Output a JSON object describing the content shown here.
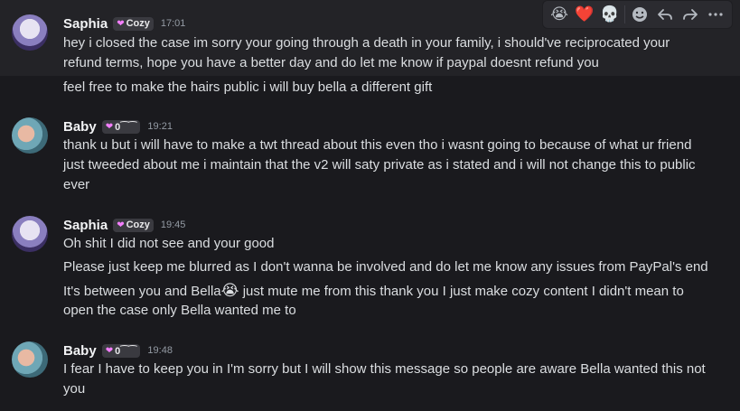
{
  "toolbar": {
    "reactions": [
      "😭",
      "❤️",
      "💀"
    ],
    "add_reaction_icon": "emoji-icon",
    "reply_icon": "reply-icon",
    "forward_icon": "forward-icon",
    "more_icon": "more-icon"
  },
  "messages": [
    {
      "author": "Saphia",
      "tag": "Cozy",
      "time": "17:01",
      "lines": [
        "hey i closed the case im sorry your going through a death in your family, i should've reciprocated your",
        "refund terms, hope you have a better day and do let me know if paypal doesnt refund you",
        "feel free to make the hairs public i will buy bella a different gift"
      ]
    },
    {
      "author": "Baby",
      "tag": "0⁀⁀",
      "time": "19:21",
      "lines": [
        "thank u but i will have to make a twt thread about this even tho i wasnt going to because of what ur friend",
        "just tweeded about me i maintain that the v2 will saty private as i stated and i will not change this to public",
        "ever"
      ]
    },
    {
      "author": "Saphia",
      "tag": "Cozy",
      "time": "19:45",
      "lines": [
        "Oh shit I did not see and your good",
        "Please just keep me blurred as I don't wanna be involved and do let me know any issues from PayPal's end",
        "It's between you and Bella",
        "😭",
        " just mute me from this thank you I just make cozy content I didn't mean to",
        "open the case only Bella wanted me to"
      ]
    },
    {
      "author": "Baby",
      "tag": "0⁀⁀",
      "time": "19:48",
      "lines": [
        "I fear I have to keep you in I'm sorry but I will show this message so people are aware Bella wanted this not",
        "you"
      ]
    }
  ],
  "colors": {
    "background": "#1a1a1e",
    "hover_background": "#232327",
    "text": "#dbdee1",
    "username": "#f2f3f5",
    "timestamp": "#949ba4",
    "tag_heart": "#f47fff"
  }
}
